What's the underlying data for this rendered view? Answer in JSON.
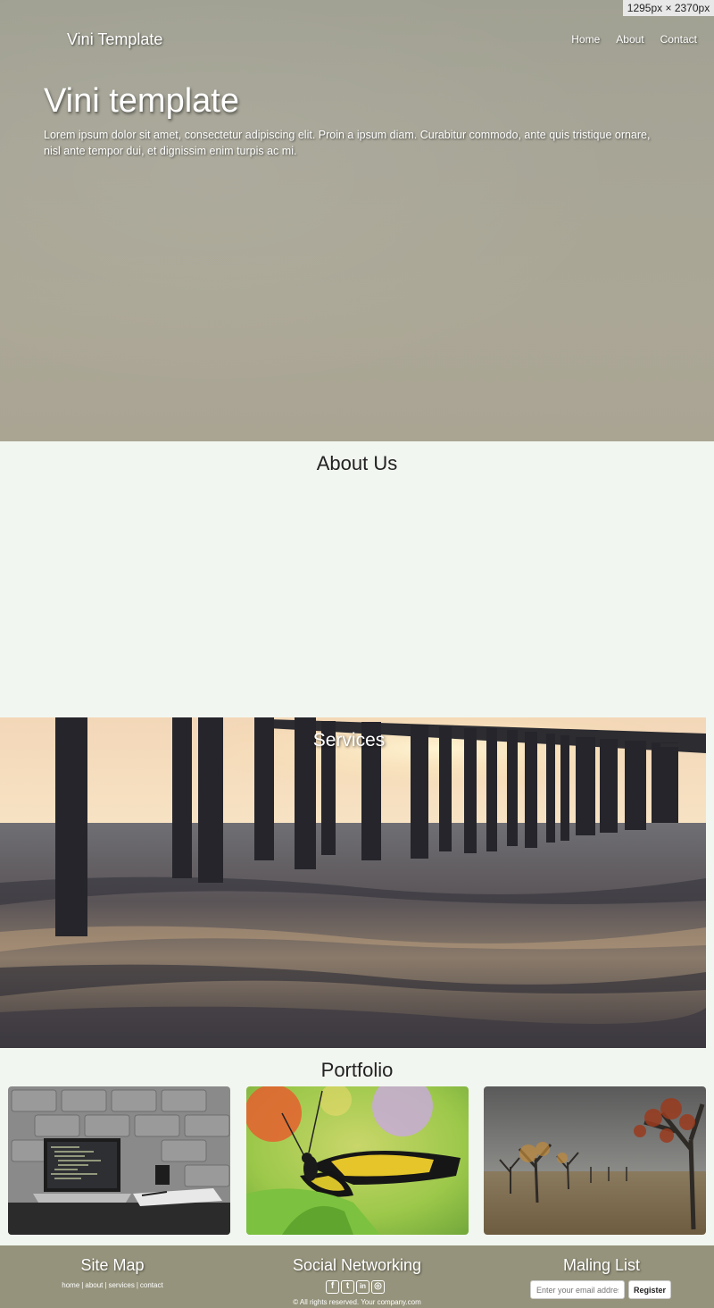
{
  "overlay": {
    "dimensions": "1295px × 2370px"
  },
  "nav": {
    "brand": "Vini Template",
    "links": [
      "Home",
      "About",
      "Contact"
    ]
  },
  "hero": {
    "title": "Vini template",
    "text": "Lorem ipsum dolor sit amet, consectetur adipiscing elit. Proin a ipsum diam. Curabitur commodo, ante quis tristique ornare, nisl ante tempor dui, et dignissim enim turpis ac mi."
  },
  "about": {
    "title": "About Us"
  },
  "services": {
    "title": "Services"
  },
  "portfolio": {
    "title": "Portfolio",
    "items": [
      "laptop-workspace-photo",
      "butterfly-photo",
      "orchard-trees-photo"
    ]
  },
  "footer": {
    "sitemap": {
      "title": "Site Map",
      "links": [
        "home",
        "about",
        "services",
        "contact"
      ],
      "separator": "|"
    },
    "social": {
      "title": "Social Networking",
      "icons": [
        "facebook-icon",
        "twitter-icon",
        "linkedin-icon",
        "instagram-icon"
      ],
      "glyphs": [
        "f",
        "t",
        "in",
        "◎"
      ]
    },
    "mailing": {
      "title": "Maling List",
      "placeholder": "Enter your email address",
      "button": "Register"
    },
    "copyright": "© All rights reserved. Your company.com"
  }
}
